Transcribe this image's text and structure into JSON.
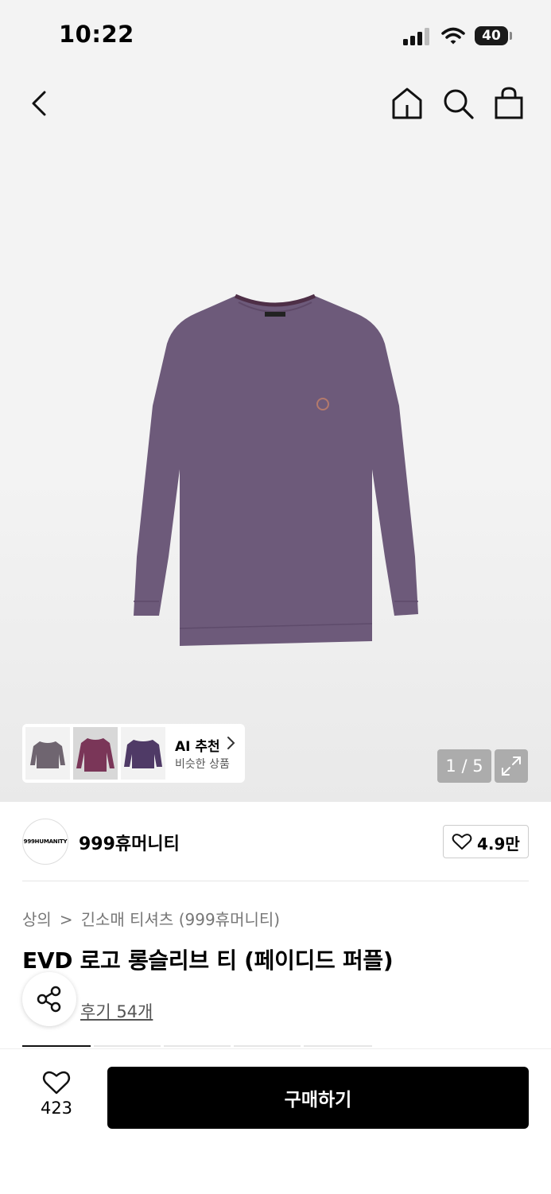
{
  "status_bar": {
    "time": "10:22",
    "battery": "40"
  },
  "gallery": {
    "counter": "1 / 5",
    "ai_card": {
      "title": "AI 추천",
      "subtitle": "비슷한 상품"
    }
  },
  "brand": {
    "logo_text": "999HUMANITY",
    "name": "999휴머니티",
    "likes": "4.9만"
  },
  "product": {
    "breadcrumb": [
      "상의",
      "긴소매 티셔츠 (999휴머니티)"
    ],
    "title": "EVD 로고 롱슬리브 티 (페이디드 퍼플)",
    "review_link": "후기 54개",
    "color": "#6d5a7a"
  },
  "bottom_bar": {
    "wish_count": "423",
    "buy_label": "구매하기"
  },
  "icons": [
    "back-icon",
    "home-icon",
    "search-icon",
    "bag-icon",
    "chevron-right-icon",
    "expand-icon",
    "heart-icon",
    "share-icon"
  ]
}
